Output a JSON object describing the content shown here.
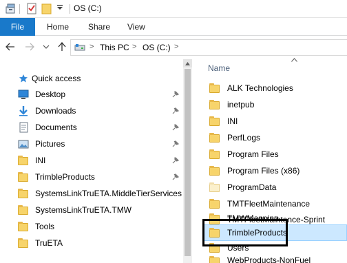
{
  "titlebar": {
    "title": "OS (C:)",
    "icons": [
      "properties-icon",
      "new-folder-icon",
      "customize-quick-access-icon"
    ]
  },
  "ribbon": {
    "tabs": [
      {
        "label": "File",
        "active": true
      },
      {
        "label": "Home"
      },
      {
        "label": "Share"
      },
      {
        "label": "View"
      }
    ]
  },
  "address_bar": {
    "icons": [
      "back-arrow-icon",
      "forward-arrow-icon",
      "recent-locations-chevron-icon",
      "up-arrow-icon"
    ],
    "crumbs": [
      "This PC",
      "OS (C:)"
    ],
    "separator": ">"
  },
  "navigation": {
    "quick_access_label": "Quick access",
    "items": [
      {
        "label": "Desktop",
        "icon": "desktop-icon",
        "pinned": true
      },
      {
        "label": "Downloads",
        "icon": "download-icon",
        "pinned": true
      },
      {
        "label": "Documents",
        "icon": "documents-icon",
        "pinned": true
      },
      {
        "label": "Pictures",
        "icon": "pictures-icon",
        "pinned": true
      },
      {
        "label": "INI",
        "icon": "folder-icon",
        "pinned": true
      },
      {
        "label": "TrimbleProducts",
        "icon": "folder-icon",
        "pinned": true
      },
      {
        "label": "SystemsLinkTruETA.MiddleTierServices",
        "icon": "folder-icon",
        "pinned": false
      },
      {
        "label": "SystemsLinkTruETA.TMW",
        "icon": "folder-icon",
        "pinned": false
      },
      {
        "label": "Tools",
        "icon": "folder-icon",
        "pinned": false
      },
      {
        "label": "TruETA",
        "icon": "folder-icon",
        "pinned": false
      }
    ]
  },
  "file_list": {
    "column_header": "Name",
    "items": [
      {
        "label": "ALK Technologies"
      },
      {
        "label": "inetpub"
      },
      {
        "label": "INI"
      },
      {
        "label": "PerfLogs"
      },
      {
        "label": "Program Files"
      },
      {
        "label": "Program Files (x86)"
      },
      {
        "label": "ProgramData",
        "hidden": true
      },
      {
        "label": "TMTFleetMaintenance"
      },
      {
        "label": "TMTFleetMaintence-Sprint"
      },
      {
        "label": "TMWMapping"
      },
      {
        "label": "TrimbleProducts",
        "selected": true
      },
      {
        "label": "Users"
      },
      {
        "label": "WebProducts-NonFuel"
      }
    ]
  },
  "colors": {
    "file_tab": "#1979ca",
    "selection": "#cce8ff",
    "folder": "#f7d46b",
    "header_text": "#4c607a"
  }
}
